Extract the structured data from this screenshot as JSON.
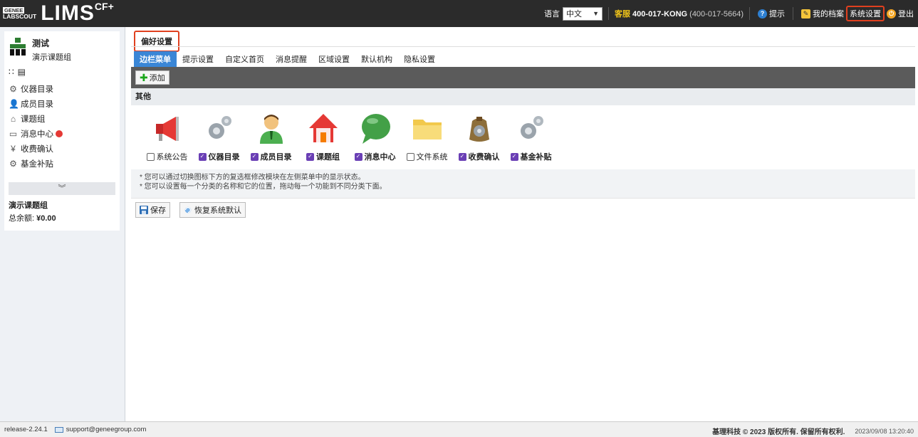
{
  "brand": {
    "geneeLabel": "GENEE",
    "labscoutLabel": "LABSCOUT",
    "product": "LIMS",
    "edition": "CF+"
  },
  "topbar": {
    "languageLabel": "语言",
    "languageValue": "中文",
    "supportLabel": "客服",
    "supportPhone": "400-017-KONG",
    "supportPhoneAlt": "(400-017-5664)",
    "help": "提示",
    "profile": "我的档案",
    "settings": "系统设置",
    "logout": "登出"
  },
  "sidebar": {
    "groupName": "测试",
    "groupSub": "演示课题组",
    "menu": [
      {
        "label": "仪器目录",
        "icon": "gear-icon"
      },
      {
        "label": "成员目录",
        "icon": "person-icon"
      },
      {
        "label": "课题组",
        "icon": "home-icon"
      },
      {
        "label": "消息中心",
        "icon": "chat-icon"
      },
      {
        "label": "收费确认",
        "icon": "yen-icon"
      },
      {
        "label": "基金补贴",
        "icon": "gear-icon"
      }
    ],
    "expand": "»",
    "balanceTitle": "演示课题组",
    "balanceLabel": "总余额:",
    "balanceValue": "¥0.00"
  },
  "main": {
    "pageTitle": "偏好设置",
    "tabs": [
      "边栏菜单",
      "提示设置",
      "自定义首页",
      "消息提醒",
      "区域设置",
      "默认机构",
      "隐私设置"
    ],
    "activeTab": 0,
    "addButton": "添加",
    "sectionTitle": "其他",
    "modules": [
      {
        "label": "系统公告",
        "checked": false,
        "icon": "megaphone-icon"
      },
      {
        "label": "仪器目录",
        "checked": true,
        "icon": "gears-icon"
      },
      {
        "label": "成员目录",
        "checked": true,
        "icon": "person-icon"
      },
      {
        "label": "课题组",
        "checked": true,
        "icon": "home-icon"
      },
      {
        "label": "消息中心",
        "checked": true,
        "icon": "chat-bubble-icon"
      },
      {
        "label": "文件系统",
        "checked": false,
        "icon": "folder-icon"
      },
      {
        "label": "收费确认",
        "checked": true,
        "icon": "moneybag-icon"
      },
      {
        "label": "基金补贴",
        "checked": true,
        "icon": "gears-icon"
      }
    ],
    "note1": "* 您可以通过切换图标下方的复选框修改模块在左侧菜单中的显示状态。",
    "note2": "* 您可以设置每一个分类的名称和它的位置，拖动每一个功能到不同分类下面。",
    "saveButton": "保存",
    "restoreButton": "恢复系统默认"
  },
  "footer": {
    "release": "release-2.24.1",
    "email": "support@geneegroup.com",
    "copyright": "基理科技 © 2023 版权所有. 保留所有权利.",
    "timestamp": "2023/09/08 13:20:40"
  }
}
